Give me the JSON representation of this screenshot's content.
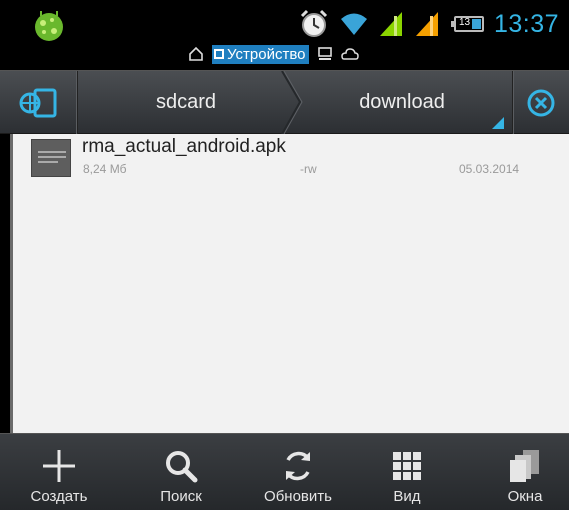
{
  "status_bar": {
    "time": "13:37",
    "battery_level": "13",
    "icons": [
      "android-bug-icon",
      "alarm-clock-icon",
      "wifi-icon",
      "signal-icon",
      "signal-icon",
      "battery-icon"
    ]
  },
  "storage_switcher": {
    "items": [
      {
        "icon": "home-icon"
      },
      {
        "icon": "device-icon",
        "label": "Устройство",
        "selected": true
      },
      {
        "icon": "computer-icon"
      },
      {
        "icon": "cloud-icon"
      }
    ]
  },
  "path_bar": {
    "panels_icon": "panels-icon",
    "crumbs": [
      "sdcard",
      "download"
    ],
    "close_icon": "close-circle-icon"
  },
  "files": [
    {
      "name": "rma_actual_android.apk",
      "size": "8,24 Мб",
      "permissions": "-rw",
      "date": "05.03.2014"
    }
  ],
  "toolbar": {
    "create_label": "Создать",
    "search_label": "Поиск",
    "refresh_label": "Обновить",
    "view_label": "Вид",
    "windows_label": "Окна"
  },
  "colors": {
    "accent": "#35b5e5",
    "selected_storage": "#1f7fc0",
    "signal": "#8bd400"
  }
}
